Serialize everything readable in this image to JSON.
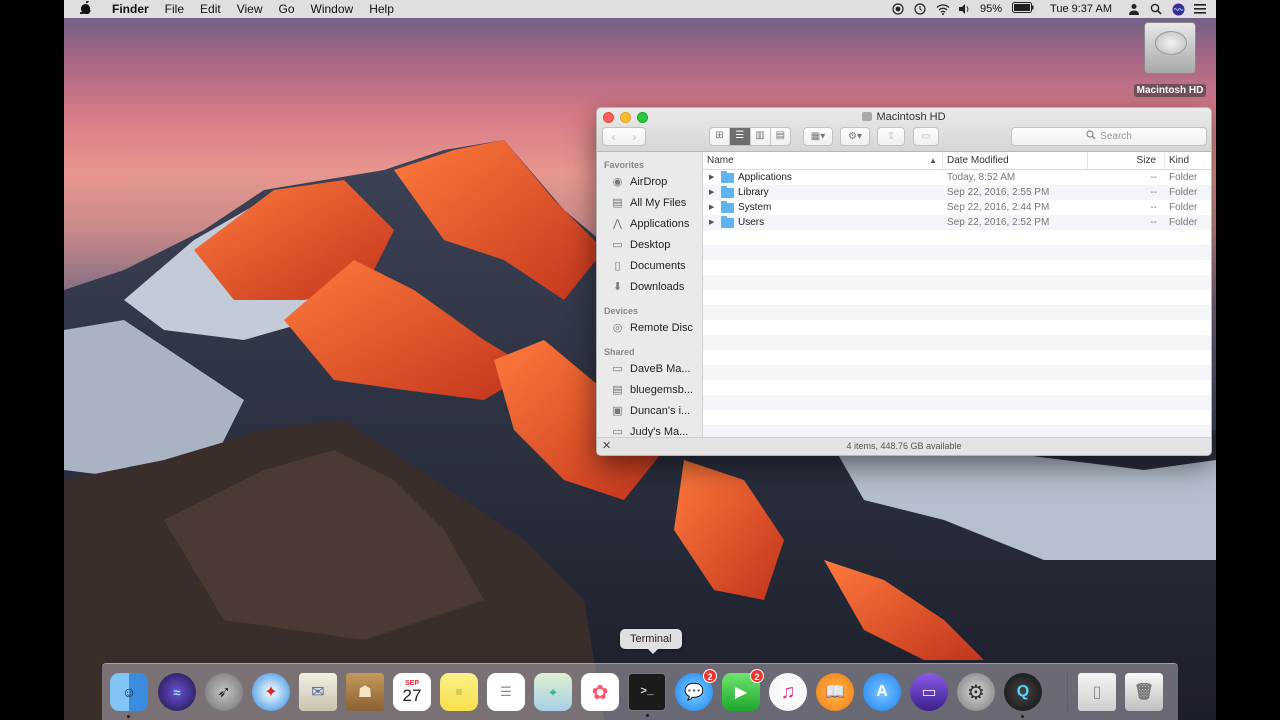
{
  "menubar": {
    "apple": "",
    "app_name": "Finder",
    "menus": [
      "File",
      "Edit",
      "View",
      "Go",
      "Window",
      "Help"
    ],
    "battery": "95%",
    "clock": "Tue 9:37 AM"
  },
  "desktop": {
    "hd_label": "Macintosh HD"
  },
  "finder": {
    "title": "Macintosh HD",
    "search_placeholder": "Search",
    "sidebar": {
      "favorites_label": "Favorites",
      "favorites": [
        "AirDrop",
        "All My Files",
        "Applications",
        "Desktop",
        "Documents",
        "Downloads"
      ],
      "devices_label": "Devices",
      "devices": [
        "Remote Disc"
      ],
      "shared_label": "Shared",
      "shared": [
        "DaveB Ma...",
        "bluegemsb...",
        "Duncan's i...",
        "Judy's Ma..."
      ]
    },
    "columns": {
      "name": "Name",
      "date": "Date Modified",
      "size": "Size",
      "kind": "Kind"
    },
    "rows": [
      {
        "name": "Applications",
        "date": "Today, 8:52 AM",
        "size": "--",
        "kind": "Folder"
      },
      {
        "name": "Library",
        "date": "Sep 22, 2016, 2:55 PM",
        "size": "--",
        "kind": "Folder"
      },
      {
        "name": "System",
        "date": "Sep 22, 2016, 2:44 PM",
        "size": "--",
        "kind": "Folder"
      },
      {
        "name": "Users",
        "date": "Sep 22, 2016, 2:52 PM",
        "size": "--",
        "kind": "Folder"
      }
    ],
    "status": "4 items, 448.76 GB available"
  },
  "dock": {
    "tooltip": "Terminal",
    "calendar_month": "SEP",
    "calendar_day": "27",
    "messages_badge": "2",
    "facetime_badge": "2"
  }
}
